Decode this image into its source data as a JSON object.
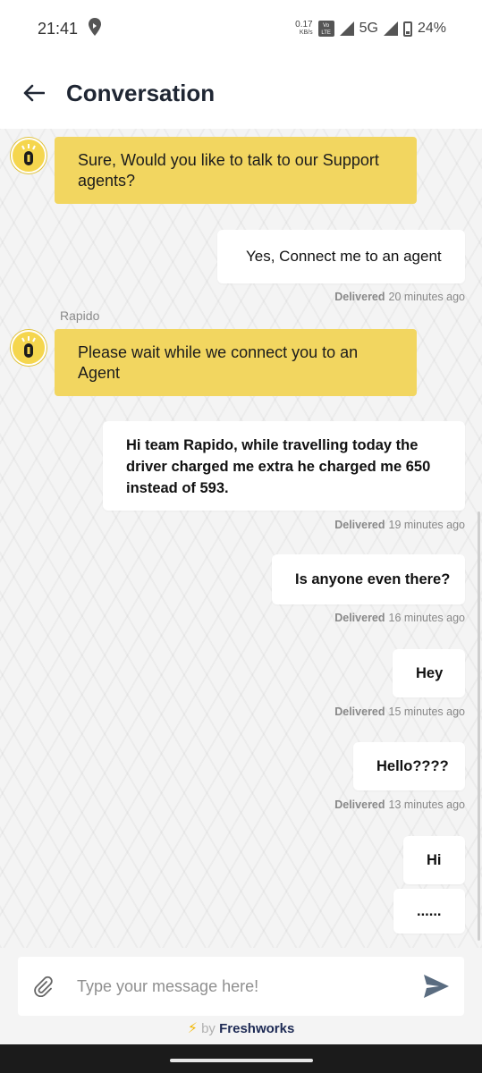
{
  "status_bar": {
    "time": "21:41",
    "net_speed_value": "0.17",
    "net_speed_unit": "KB/s",
    "volte_label": "Vo LTE",
    "network": "5G",
    "battery": "24%"
  },
  "header": {
    "title": "Conversation"
  },
  "messages": [
    {
      "type": "bot",
      "text": "Sure, Would you like to talk to our Support agents?"
    },
    {
      "type": "user",
      "text": "Yes, Connect me to an agent",
      "status": "Delivered",
      "time": "20 minutes ago"
    },
    {
      "type": "bot",
      "sender": "Rapido",
      "text": "Please wait while we connect you to an Agent"
    },
    {
      "type": "user",
      "text": "Hi team Rapido, while travelling today the driver charged me extra he charged me 650 instead of 593.",
      "status": "Delivered",
      "time": "19 minutes ago"
    },
    {
      "type": "user",
      "text": "Is anyone even there?",
      "status": "Delivered",
      "time": "16 minutes ago"
    },
    {
      "type": "user",
      "text": "Hey",
      "status": "Delivered",
      "time": "15 minutes ago"
    },
    {
      "type": "user",
      "text": "Hello????",
      "status": "Delivered",
      "time": "13 minutes ago"
    },
    {
      "type": "user",
      "text": "Hi"
    },
    {
      "type": "user",
      "text": "......"
    }
  ],
  "composer": {
    "placeholder": "Type your message here!",
    "powered_by_prefix": "by",
    "powered_by_brand": "Freshworks"
  },
  "colors": {
    "bot_bubble": "#f2d660",
    "avatar": "#f5d64e",
    "send_icon": "#5a6c80",
    "brand_text": "#1d2a54"
  },
  "icons": [
    "back-arrow-icon",
    "attach-icon",
    "send-icon",
    "bolt-icon",
    "rapido-bot-icon",
    "location-icon",
    "signal-icon",
    "battery-icon"
  ]
}
